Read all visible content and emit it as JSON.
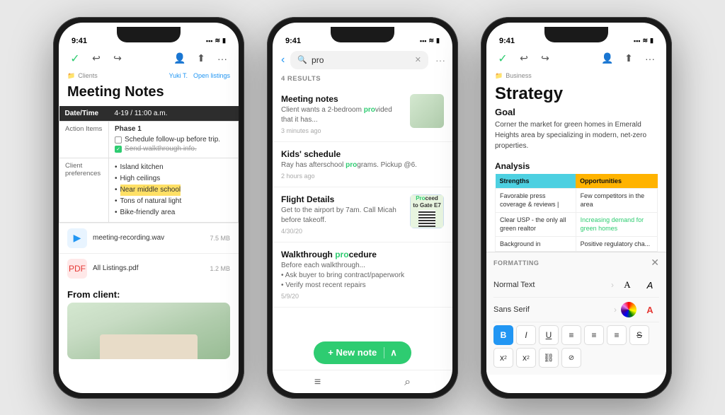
{
  "phone1": {
    "status_time": "9:41",
    "toolbar": {
      "check": "✓",
      "undo": "↩",
      "redo": "↪",
      "user": "👤",
      "share": "⬆",
      "more": "···"
    },
    "breadcrumb": "Clients",
    "breadcrumb_action": "Open listings",
    "breadcrumb_user": "Yuki T.",
    "title": "Meeting Notes",
    "table": {
      "col1": "Date/Time",
      "col2": "4-19 / 11:00 a.m.",
      "action_label": "Action Items",
      "phase": "Phase 1",
      "checkbox1": "Schedule follow-up before trip.",
      "checkbox1_checked": false,
      "checkbox2": "Send walkthrough info.",
      "checkbox2_checked": true,
      "prefs_label": "Client preferences",
      "pref1": "Island kitchen",
      "pref2": "High ceilings",
      "pref3": "Near middle school",
      "pref4": "Tons of natural light",
      "pref5": "Bike-friendly area"
    },
    "attachment1_icon": "▶",
    "attachment1_name": "meeting-recording.wav",
    "attachment1_size": "7.5 MB",
    "attachment2_icon": "📄",
    "attachment2_name": "All Listings.pdf",
    "attachment2_size": "1.2 MB",
    "from_client": "From client:"
  },
  "phone2": {
    "status_time": "9:41",
    "search_placeholder": "pro",
    "results_count": "4 RESULTS",
    "result1_title": "Meeting notes",
    "result1_snippet": "Client wants a 2-bedroom provided that it has...",
    "result1_time": "3 minutes ago",
    "result2_title": "Kids' schedule",
    "result2_snippet": "Ray has afterschool programs. Pickup @6.",
    "result2_time": "2 hours ago",
    "result3_title": "Flight Details",
    "result3_snippet": "Get to the airport by 7am. Call Micah before takeoff.",
    "result3_time": "4/30/20",
    "result3_thumb_line1": "Proceed",
    "result3_thumb_line2": "to Gate E7",
    "result4_title": "Walkthrough procedure",
    "result4_snippet1": "Before each walkthrough...",
    "result4_bullet1": "Ask buyer to bring contract/paperwork",
    "result4_bullet2": "Verify most recent repairs",
    "result4_time": "5/9/20",
    "new_note": "+ New note",
    "new_note_chevron": "∧",
    "bottom_nav_menu": "≡",
    "bottom_nav_search": "⌕"
  },
  "phone3": {
    "status_time": "9:41",
    "toolbar": {
      "check": "✓",
      "undo": "↩",
      "redo": "↪"
    },
    "breadcrumb": "Business",
    "title": "Strategy",
    "goal_label": "Goal",
    "goal_text": "Corner the market for green homes in Emerald Heights area by specializing in modern, net-zero properties.",
    "analysis_label": "Analysis",
    "col_strengths": "Strengths",
    "col_opportunities": "Opportunities",
    "cell_s1": "Favorable press coverage & reviews |",
    "cell_o1": "Few competitors in the area",
    "cell_s2": "Clear USP - the only all green realtor",
    "cell_o2_link": "Increasing demand for green homes",
    "cell_s3": "Background in",
    "cell_o3": "Positive regulatory cha...",
    "formatting": {
      "title": "FORMATTING",
      "close": "✕",
      "row1_label": "Normal Text",
      "row2_label": "Sans Serif",
      "btn_bold": "B",
      "btn_italic": "I",
      "btn_underline": "U",
      "btn_align_left": "≡",
      "btn_align_center": "≡",
      "btn_align_right": "≡",
      "btn_strike": "S̶",
      "btn_sup": "x²",
      "btn_sub": "x₂",
      "btn_link": "⛓",
      "btn_more": "⊘"
    }
  }
}
